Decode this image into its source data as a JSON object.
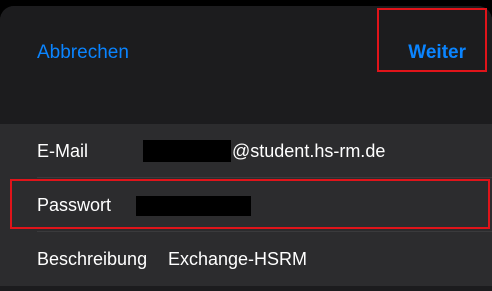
{
  "nav": {
    "cancel_label": "Abbrechen",
    "next_label": "Weiter"
  },
  "form": {
    "email": {
      "label": "E-Mail",
      "value_suffix": "@student.hs-rm.de"
    },
    "password": {
      "label": "Passwort"
    },
    "description": {
      "label": "Beschreibung",
      "value": "Exchange-HSRM"
    }
  },
  "colors": {
    "accent": "#0a84ff",
    "highlight": "#e0141a",
    "redaction": "#000000"
  }
}
